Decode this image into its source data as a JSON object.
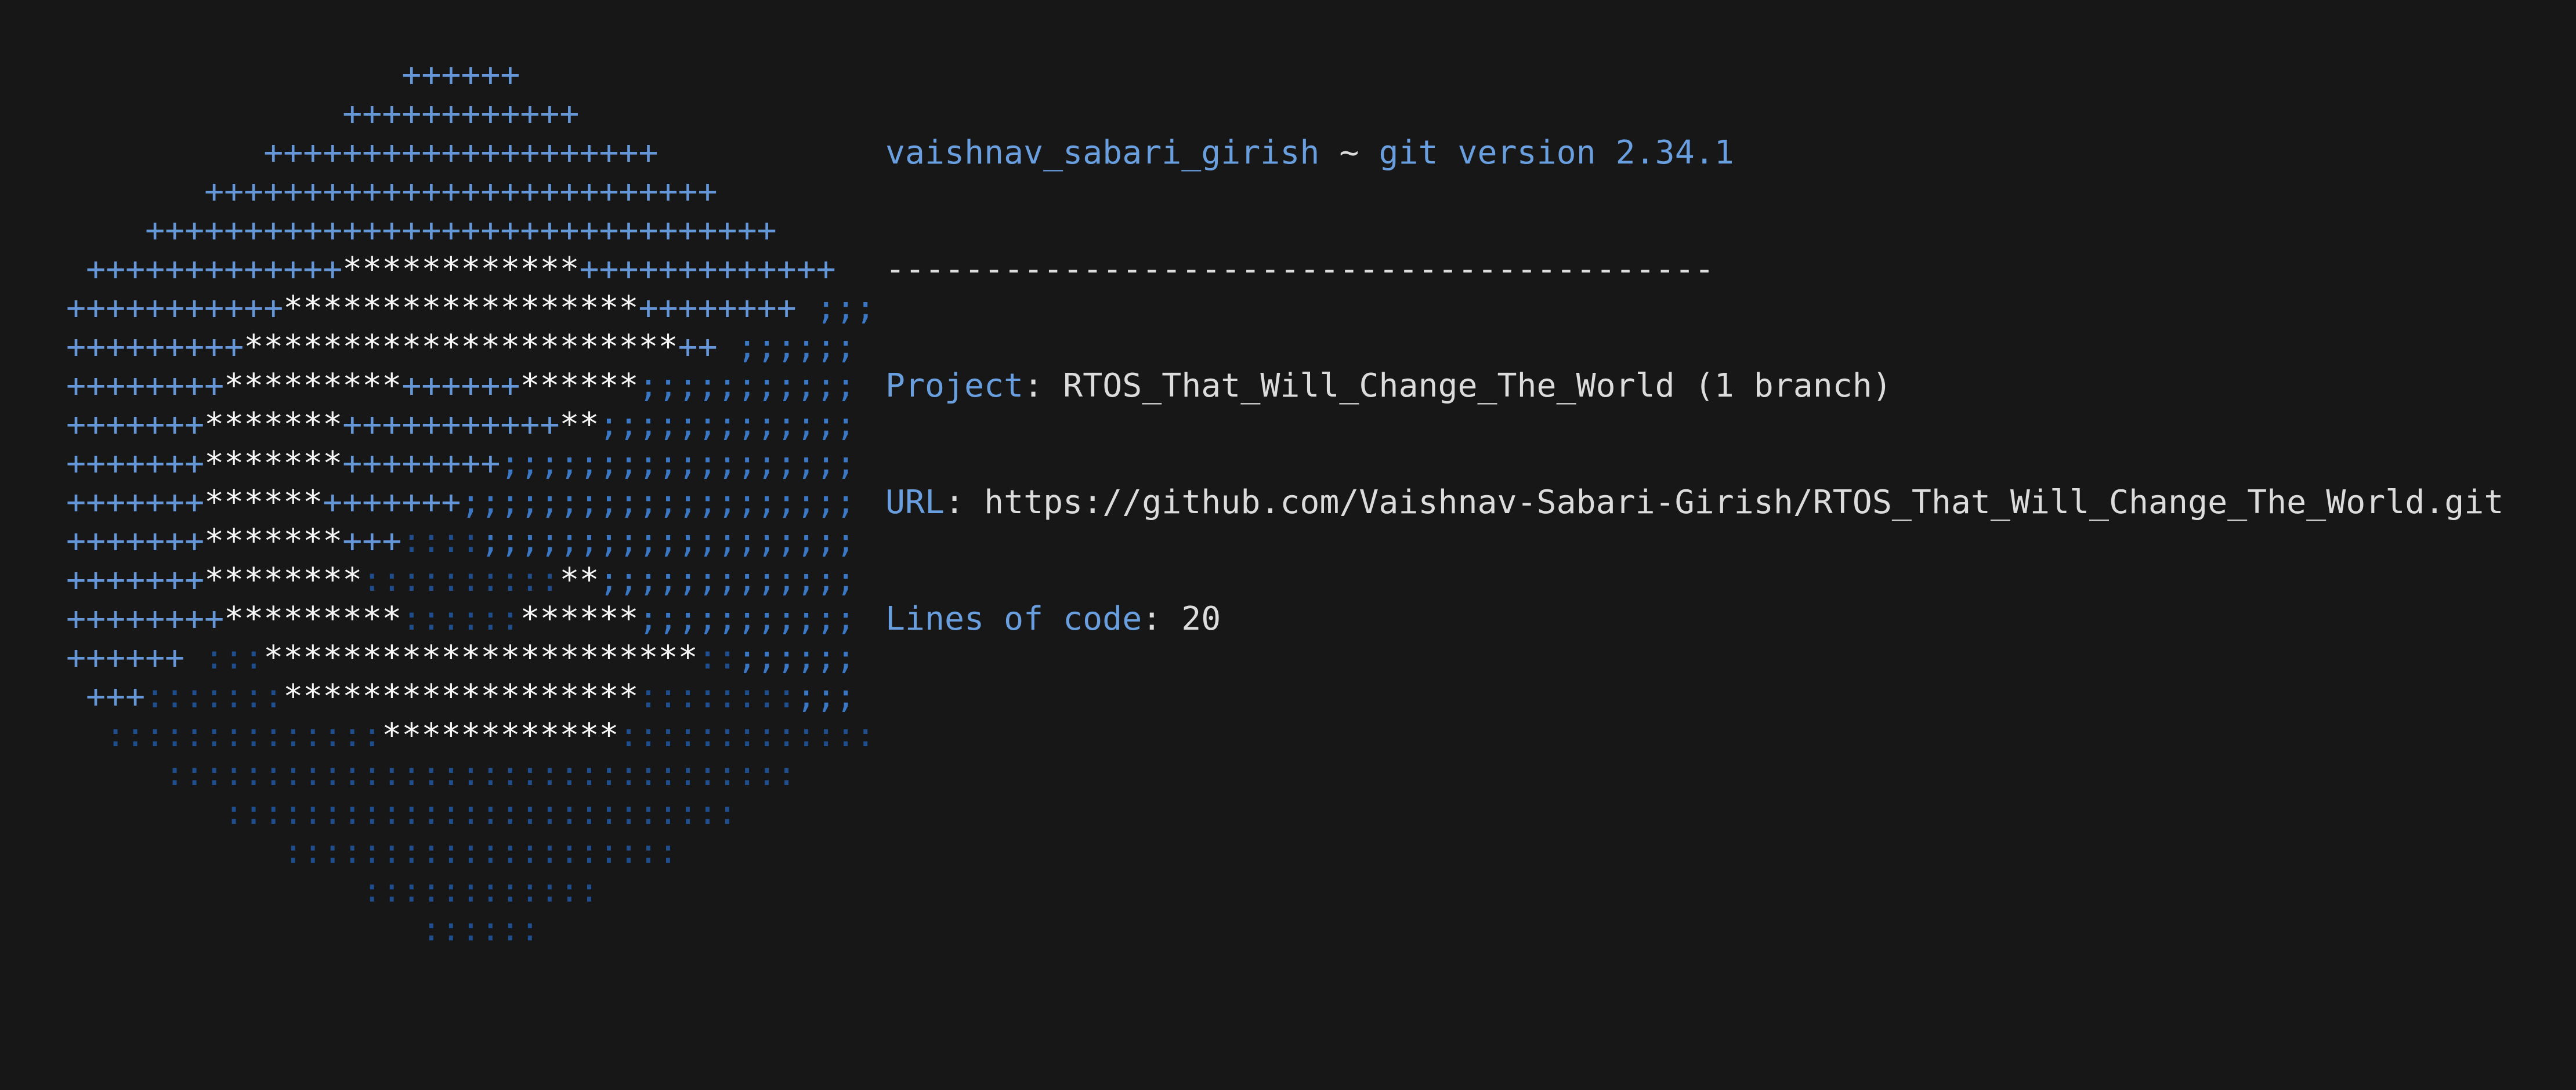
{
  "colors": {
    "background": "#171717",
    "accent": "#6a9fdf",
    "text": "#dcdcdc",
    "logo_plus": "#6496d8",
    "logo_star": "#f6f6f6",
    "logo_semicolon": "#3a78c5",
    "logo_colon": "#1f4e8f"
  },
  "logo": {
    "lines": [
      "                  ++++++",
      "               ++++++++++++",
      "           ++++++++++++++++++++",
      "        ++++++++++++++++++++++++++",
      "     ++++++++++++++++++++++++++++++++",
      "  +++++++++++++************+++++++++++++",
      " +++++++++++******************++++++++ ;;;",
      " +++++++++**********************++ ;;;;;;",
      " ++++++++*********++++++******;;;;;;;;;;;",
      " +++++++*******+++++++++++**;;;;;;;;;;;;;",
      " +++++++*******++++++++;;;;;;;;;;;;;;;;;;",
      " +++++++******+++++++;;;;;;;;;;;;;;;;;;;;",
      " +++++++*******+++::::;;;;;;;;;;;;;;;;;;;",
      " +++++++********::::::::::**;;;;;;;;;;;;;",
      " ++++++++*********::::::******;;;;;;;;;;;",
      " ++++++ :::**********************::;;;;;;",
      "  +++:::::::******************::::::::;;;",
      "   ::::::::::::::************:::::::::::::",
      "      ::::::::::::::::::::::::::::::::",
      "         ::::::::::::::::::::::::::",
      "            ::::::::::::::::::::",
      "                ::::::::::::",
      "                   ::::::"
    ]
  },
  "info": {
    "user": "vaishnav_sabari_girish",
    "separator_symbol": "~",
    "git_version": "git version 2.34.1",
    "divider": "------------------------------------------",
    "project_label": "Project",
    "project_value": "RTOS_That_Will_Change_The_World (1 branch)",
    "url_label": "URL",
    "url_value": "https://github.com/Vaishnav-Sabari-Girish/RTOS_That_Will_Change_The_World.git",
    "loc_label": "Lines of code",
    "loc_value": "20",
    "colon": ": "
  }
}
